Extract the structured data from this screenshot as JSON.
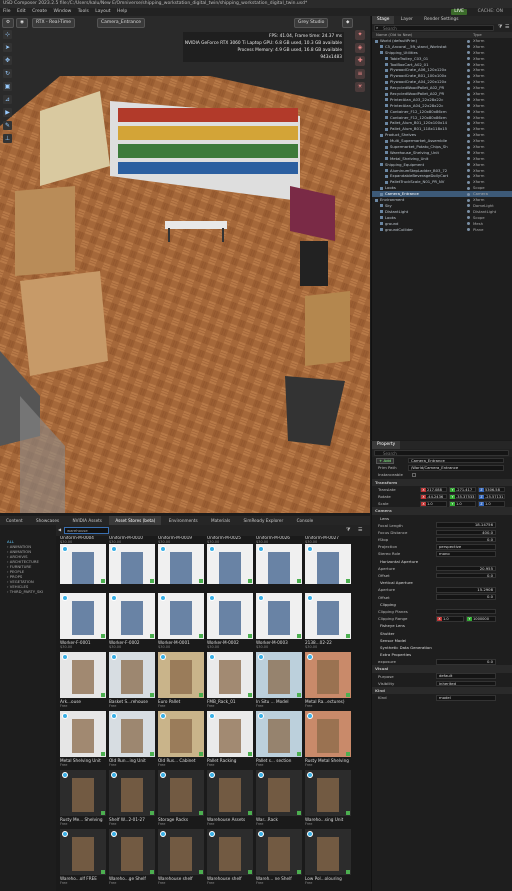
{
  "window": {
    "title": "USD Composer   2023.2.5   file:/C:/Users/kalu/New E/Omniverse/shipping_workstation_digital_twin/shipping_workstation_digital_twin.usd*",
    "live": "LIVE",
    "cache": "CACHE: ON"
  },
  "menu": [
    "File",
    "Edit",
    "Create",
    "Window",
    "Tools",
    "Layout",
    "Help"
  ],
  "viewport": {
    "renderer": "RTX - Real-Time",
    "camera": "Camera_Entrance",
    "lighting": "Grey Studio",
    "stats": [
      "FPS: 41.04, Frame time: 24.37 ms",
      "NVIDIA GeForce RTX 3060 Ti Laptop GPU: 6.8 GB used, 10.3 GB available",
      "Process Memory: 4.9 GB used, 16.8 GB available",
      "943x1483"
    ]
  },
  "stage": {
    "tabs": [
      "Stage",
      "Layer",
      "Render Settings"
    ],
    "search_placeholder": "Search",
    "col_name": "Name (Old to New)",
    "col_type": "Type",
    "rows": [
      {
        "n": "World (defaultPrim)",
        "t": "Xform",
        "i": 0
      },
      {
        "n": "C5_Ancoral__5ft_stand_Workstat",
        "t": "Xform",
        "i": 1
      },
      {
        "n": "Shipping_Utilities",
        "t": "Xform",
        "i": 1
      },
      {
        "n": "TableTrolley_C03_01",
        "t": "Xform",
        "i": 2
      },
      {
        "n": "ToolBoxCart_A02_01",
        "t": "Xform",
        "i": 2
      },
      {
        "n": "PlywoodCrate_A06_120x120x",
        "t": "Xform",
        "i": 2
      },
      {
        "n": "PlywoodCrate_B01_100x100x",
        "t": "Xform",
        "i": 2
      },
      {
        "n": "PlywoodCrate_A04_220x120x",
        "t": "Xform",
        "i": 2
      },
      {
        "n": "RecycledWoodPallet_A02_PR",
        "t": "Xform",
        "i": 2
      },
      {
        "n": "RecycledWoodPallet_A02_PR",
        "t": "Xform",
        "i": 2
      },
      {
        "n": "PrinterAlan_A03_22x28x22c",
        "t": "Xform",
        "i": 2
      },
      {
        "n": "PrinterAlan_A04_22x28x22c",
        "t": "Xform",
        "i": 2
      },
      {
        "n": "Container_F12_120x80x86cm",
        "t": "Xform",
        "i": 2
      },
      {
        "n": "Container_F12_120x80x86cm",
        "t": "Xform",
        "i": 2
      },
      {
        "n": "Pallet_Alum_B01_120x100x14",
        "t": "Xform",
        "i": 2
      },
      {
        "n": "Pallet_Alum_B01_118x118x15",
        "t": "Xform",
        "i": 2
      },
      {
        "n": "Product_Shelves",
        "t": "Xform",
        "i": 1
      },
      {
        "n": "Multi_Supermarket_Assemblie",
        "t": "Xform",
        "i": 2
      },
      {
        "n": "Supermarket_Potato_Chips_Sh",
        "t": "Xform",
        "i": 2
      },
      {
        "n": "Warehouse_Shelving_Unit",
        "t": "Xform",
        "i": 2
      },
      {
        "n": "Metal_Shelving_Unit",
        "t": "Xform",
        "i": 2
      },
      {
        "n": "Shipping_Equipment",
        "t": "Xform",
        "i": 1
      },
      {
        "n": "AluminumStepLadder_B03_72",
        "t": "Xform",
        "i": 2
      },
      {
        "n": "ExpandableBeverageDollyCart",
        "t": "Xform",
        "i": 2
      },
      {
        "n": "PalletTruckScale_N01_PR_NV",
        "t": "Xform",
        "i": 2
      },
      {
        "n": "Looks",
        "t": "Scope",
        "i": 1
      },
      {
        "n": "Camera_Entrance",
        "t": "Camera",
        "i": 1,
        "sel": true
      },
      {
        "n": "Environment",
        "t": "Xform",
        "i": 0
      },
      {
        "n": "Sky",
        "t": "DomeLight",
        "i": 1
      },
      {
        "n": "DistantLight",
        "t": "DistantLight",
        "i": 1
      },
      {
        "n": "Looks",
        "t": "Scope",
        "i": 1
      },
      {
        "n": "ground",
        "t": "Mesh",
        "i": 1
      },
      {
        "n": "groundCollider",
        "t": "Plane",
        "i": 1
      }
    ]
  },
  "property": {
    "tab": "Property",
    "search_placeholder": "Search",
    "add_label": "+ Add",
    "prim_name": "Camera_Entrance",
    "prim_path_label": "Prim Path",
    "prim_path": "/World/Camera_Entrance",
    "instanceable_label": "Instanceable",
    "transform": "Transform",
    "translate_label": "Translate",
    "translate": [
      "217.088",
      "-271.417",
      "5306.58"
    ],
    "rotate_label": "Rotate",
    "rotate": [
      "-44.2436",
      "-35.37533",
      "-25.57131"
    ],
    "scale_label": "Scale",
    "scale": [
      "1.0",
      "1.0",
      "1.0"
    ],
    "camera": "Camera",
    "lens": "Lens",
    "focal_length_label": "Focal Length",
    "focal_length": "18.14756",
    "focus_distance_label": "Focus Distance",
    "focus_distance": "400.0",
    "fstop_label": "fStop",
    "fstop": "0.0",
    "projection_label": "Projection",
    "projection": "perspective",
    "stereo_role_label": "Stereo Role",
    "stereo_role": "mono",
    "h_aperture": "Horizontal Aperture",
    "aperture_label": "Aperture",
    "h_aperture_val": "20.955",
    "offset_label": "Offset",
    "h_offset": "0.0",
    "v_aperture": "Vertical Aperture",
    "v_aperture_val": "15.2908",
    "v_offset": "0.0",
    "clipping": "Clipping",
    "clipping_planes_label": "Clipping Planes",
    "clipping_range_label": "Clipping Range",
    "clip_near": "1.0",
    "clip_far": "1000000",
    "fisheye": "Fisheye Lens",
    "shutter": "Shutter",
    "sensor": "Sensor Model",
    "sdg": "Synthetic Data Generation",
    "extra": "Extra Properties",
    "exposure_label": "exposure",
    "exposure": "0.0",
    "visual": "Visual",
    "purpose_label": "Purpose",
    "purpose": "default",
    "visibility_label": "Visibility",
    "visibility": "inherited",
    "kind_sec": "Kind",
    "kind_label": "Kind",
    "kind": "model"
  },
  "bottom_tabs": [
    "Content",
    "Showcases",
    "NVIDIA Assets",
    "Asset Stores (beta)",
    "Environments",
    "Materials",
    "SimReady Explorer",
    "Console"
  ],
  "categories": [
    "ALL",
    "ANIMATION",
    "ANIMATION",
    "ARCHIVIS",
    "ARCHITECTURE",
    "FURNITURE",
    "PEOPLE",
    "PROPS",
    "VEGETATION",
    "VEHICLES",
    "THIRD_PARTY_SKI"
  ],
  "asset_search": "warehouse",
  "assets": [
    {
      "n": "Uniform-M-0004",
      "p": "$30.00"
    },
    {
      "n": "Uniform-M-0010",
      "p": "$30.00"
    },
    {
      "n": "Uniform-M-0019",
      "p": "$30.00"
    },
    {
      "n": "Uniform-M-0025",
      "p": "$30.00"
    },
    {
      "n": "Uniform-M-0026",
      "p": "$30.00"
    },
    {
      "n": "Uniform-M-0027",
      "p": "$30.00"
    },
    {
      "n": "Worker-F-0001",
      "p": "$30.00"
    },
    {
      "n": "Worker-F-0002",
      "p": "$30.00"
    },
    {
      "n": "Worker-M-0001",
      "p": "$30.00"
    },
    {
      "n": "Worker-M-0002",
      "p": "$30.00"
    },
    {
      "n": "Worker-M-0003",
      "p": "$30.00"
    },
    {
      "n": "2138...02-22",
      "p": "$30.00"
    },
    {
      "n": "Ark...ouse",
      "p": "Free"
    },
    {
      "n": "Basket S...rehouse",
      "p": "Free"
    },
    {
      "n": "Euro Pallet",
      "p": "Free"
    },
    {
      "n": "FMB_Rack_01",
      "p": "Free"
    },
    {
      "n": "In Situ ... Model",
      "p": "Free"
    },
    {
      "n": "Metal Ra...ectures)",
      "p": "Free"
    },
    {
      "n": "Metal Shelving Unit",
      "p": "Free"
    },
    {
      "n": "Old Run...ing Unit",
      "p": "Free"
    },
    {
      "n": "Old Rus... Cabinet",
      "p": "Free"
    },
    {
      "n": "Pallet Racking",
      "p": "Free"
    },
    {
      "n": "Pallet s... section",
      "p": "Free"
    },
    {
      "n": "Rusty Metal Shelving",
      "p": "Free"
    },
    {
      "n": "Rusty Me... Shelving",
      "p": "Free"
    },
    {
      "n": "Shelf W...2-01-27",
      "p": "Free"
    },
    {
      "n": "Storage Racks",
      "p": "Free"
    },
    {
      "n": "Warehouse Assets",
      "p": "Free"
    },
    {
      "n": "War...Rack",
      "p": "Free"
    },
    {
      "n": "Wareho...sing Unit",
      "p": "Free"
    },
    {
      "n": "Wareho...olf FREE",
      "p": "Free"
    },
    {
      "n": "Wareho...ge Shelf",
      "p": "Free"
    },
    {
      "n": "Warehouse shelf",
      "p": "Free"
    },
    {
      "n": "Warehouse shelf",
      "p": "Free"
    },
    {
      "n": "Wareh... ne Shelf",
      "p": "Free"
    },
    {
      "n": "Low Pol...olouring",
      "p": "Free"
    }
  ],
  "colors": {
    "accent": "#3ab0e6",
    "selection": "#3d5a78",
    "floor": "#a86a3a"
  }
}
